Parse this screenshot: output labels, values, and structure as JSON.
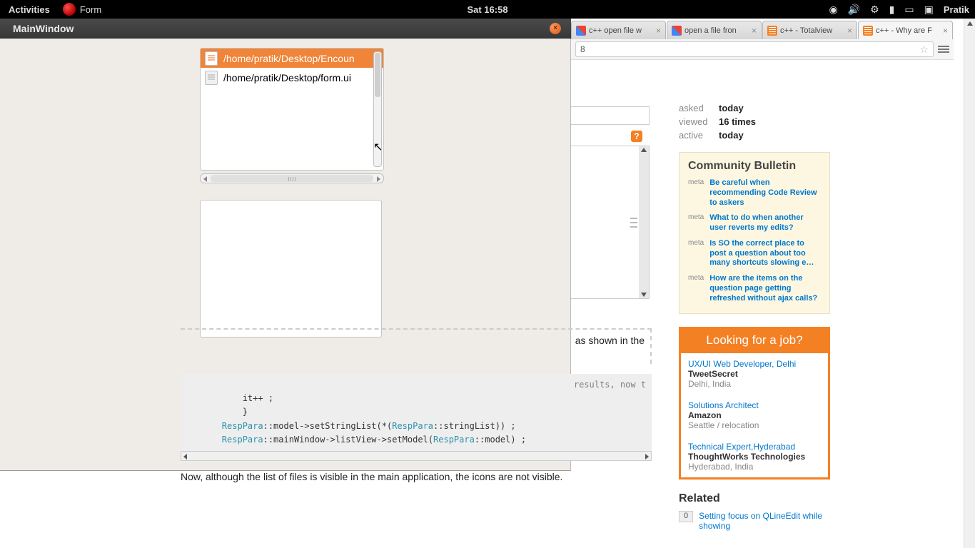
{
  "topbar": {
    "activities": "Activities",
    "app_name": "Form",
    "clock": "Sat 16:58",
    "user": "Pratik"
  },
  "qt_window": {
    "title": "MainWindow",
    "list_items": [
      "/home/pratik/Desktop/Encoun",
      "/home/pratik/Desktop/form.ui"
    ]
  },
  "browser": {
    "tabs": [
      {
        "label": "c++ open file w",
        "fav": "google"
      },
      {
        "label": "open a file fron",
        "fav": "google"
      },
      {
        "label": "c++ - Totalview",
        "fav": "so"
      },
      {
        "label": "c++ - Why are F",
        "fav": "so",
        "active": true
      }
    ],
    "url": "8",
    "stats": {
      "asked_k": "asked",
      "asked_v": "today",
      "viewed_k": "viewed",
      "viewed_v": "16 times",
      "active_k": "active",
      "active_v": "today"
    },
    "bulletin_title": "Community Bulletin",
    "bulletin": [
      {
        "src": "meta",
        "lnk": "Be careful when recommending Code Review to askers"
      },
      {
        "src": "meta",
        "lnk": "What to do when another user reverts my edits?"
      },
      {
        "src": "meta",
        "lnk": "Is SO the correct place to post a question about too many shortcuts slowing e…"
      },
      {
        "src": "meta",
        "lnk": "How are the items on the question page getting refreshed without ajax calls?"
      }
    ],
    "jobs_title": "Looking for a job?",
    "jobs": [
      {
        "t": "UX/UI Web Developer, Delhi",
        "c": "TweetSecret",
        "loc": "Delhi, India"
      },
      {
        "t": "Solutions Architect",
        "c": "Amazon",
        "loc": "Seattle / relocation"
      },
      {
        "t": "Technical Expert,Hyderabad",
        "c": "ThoughtWorks Technologies",
        "loc": "Hyderabad, India"
      }
    ],
    "related_h": "Related",
    "related": {
      "cnt": "0",
      "lnk": "Setting focus on QLineEdit while showing"
    }
  },
  "content": {
    "desc_fragment": "as shown in the",
    "code_line0_comment": "results, now t",
    "code_line1_indent": "            it++ ;",
    "code_line2_brace": "            }",
    "code_line3a": "        ",
    "code_line3b": "RespPara",
    "code_line3c": "::model->setStringList(*(",
    "code_line3d": "RespPara",
    "code_line3e": "::stringList)) ;",
    "code_line4a": "        ",
    "code_line4b": "RespPara",
    "code_line4c": "::mainWindow->listView->setModel(",
    "code_line4d": "RespPara",
    "code_line4e": "::model) ;",
    "para": "Now, although the list of files is visible in the main application, the icons are not visible."
  }
}
